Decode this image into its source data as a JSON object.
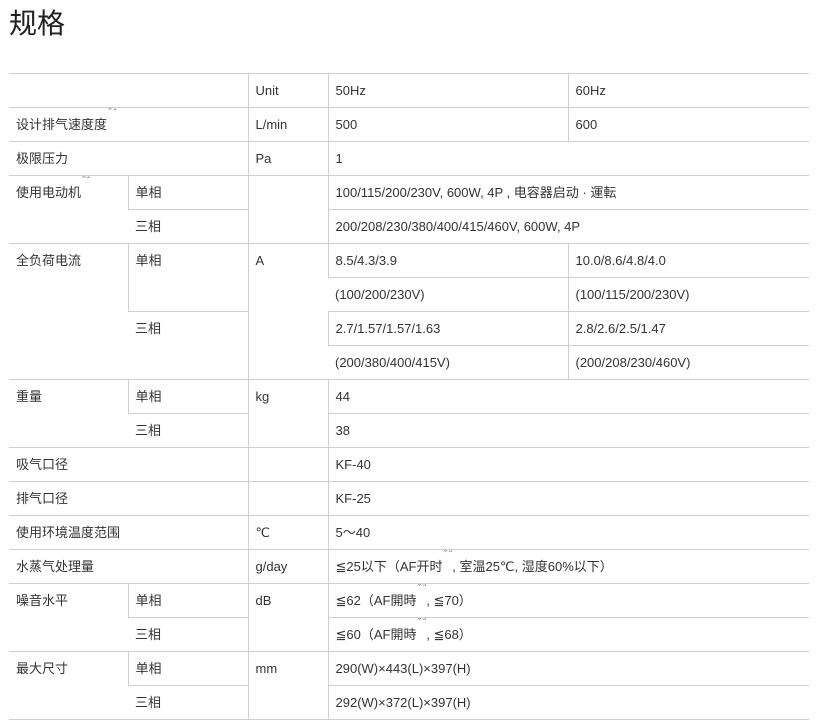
{
  "title": "规格",
  "header": {
    "unit": "Unit",
    "hz50": "50Hz",
    "hz60": "60Hz"
  },
  "rows": {
    "speed": {
      "label": "设计排气速度度",
      "note": "※1",
      "unit": "L/min",
      "v50": "500",
      "v60": "600"
    },
    "pressure": {
      "label": "极限压力",
      "unit": "Pa",
      "value": "1"
    },
    "motor": {
      "label": "使用电动机",
      "note": "※2",
      "single": "单相",
      "single_value": "100/115/200/230V, 600W, 4P , 电容器启动 · 運転",
      "three": "三相",
      "three_value": "200/208/230/380/400/415/460V, 600W, 4P"
    },
    "current": {
      "label": "全负荷电流",
      "unit": "A",
      "single": "单相",
      "single_v50": "8.5/4.3/3.9",
      "single_v60": "10.0/8.6/4.8/4.0",
      "single_v50_volt": "(100/200/230V)",
      "single_v60_volt": "(100/115/200/230V)",
      "three": "三相",
      "three_v50": "2.7/1.57/1.57/1.63",
      "three_v60": "2.8/2.6/2.5/1.47",
      "three_v50_volt": "(200/380/400/415V)",
      "three_v60_volt": "(200/208/230/460V)"
    },
    "weight": {
      "label": "重量",
      "unit": "kg",
      "single": "单相",
      "single_value": "44",
      "three": "三相",
      "three_value": "38"
    },
    "intake": {
      "label": "吸气口径",
      "value": "KF-40"
    },
    "exhaust": {
      "label": "排气口径",
      "value": "KF-25"
    },
    "temp": {
      "label": "使用环境温度范围",
      "unit": "℃",
      "value": "5～40"
    },
    "vapor": {
      "label": "水蒸气处理量",
      "unit": "g/day",
      "value_a": "≦25以下（AF开时",
      "note": "※3",
      "value_b": ", 室温25℃, 湿度60%以下）"
    },
    "noise": {
      "label": "噪音水平",
      "unit": "dB",
      "single": "单相",
      "single_a": "≦62（AF開時",
      "single_note": "※3",
      "single_b": ", ≦70）",
      "three": "三相",
      "three_a": "≦60（AF開時",
      "three_note": "※3",
      "three_b": ", ≦68）"
    },
    "size": {
      "label": "最大尺寸",
      "unit": "mm",
      "single": "单相",
      "single_value": "290(W)×443(L)×397(H)",
      "three": "三相",
      "three_value": "292(W)×372(L)×397(H)"
    }
  }
}
